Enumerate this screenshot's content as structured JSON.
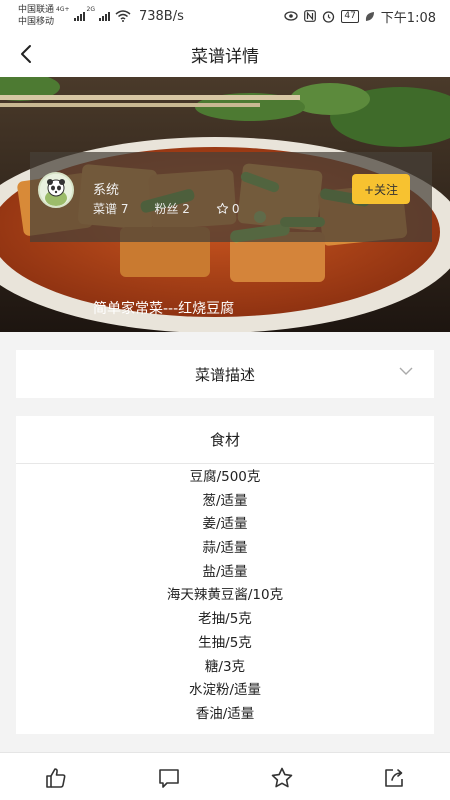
{
  "status": {
    "carrier1": "中国联通",
    "carrier2": "中国移动",
    "net1": "4G+",
    "net2": "2G",
    "speed": "738B/s",
    "battery": "47",
    "time": "下午1:08"
  },
  "header": {
    "title": "菜谱详情"
  },
  "author": {
    "name": "系统",
    "recipes": "菜谱 7",
    "fans": "粉丝 2",
    "favorites": "0",
    "follow_label": "+关注"
  },
  "recipe": {
    "name": "简单家常菜---红烧豆腐"
  },
  "description": {
    "title": "菜谱描述"
  },
  "ingredients": {
    "title": "食材",
    "items": [
      "豆腐/500克",
      "葱/适量",
      "姜/适量",
      "蒜/适量",
      "盐/适量",
      "海天辣黄豆酱/10克",
      "老抽/5克",
      "生抽/5克",
      "糖/3克",
      "水淀粉/适量",
      "香油/适量"
    ]
  },
  "bottom_bar": [
    "like-icon",
    "comment-icon",
    "star-icon",
    "share-icon"
  ],
  "colors": {
    "accent": "#f7c230"
  }
}
